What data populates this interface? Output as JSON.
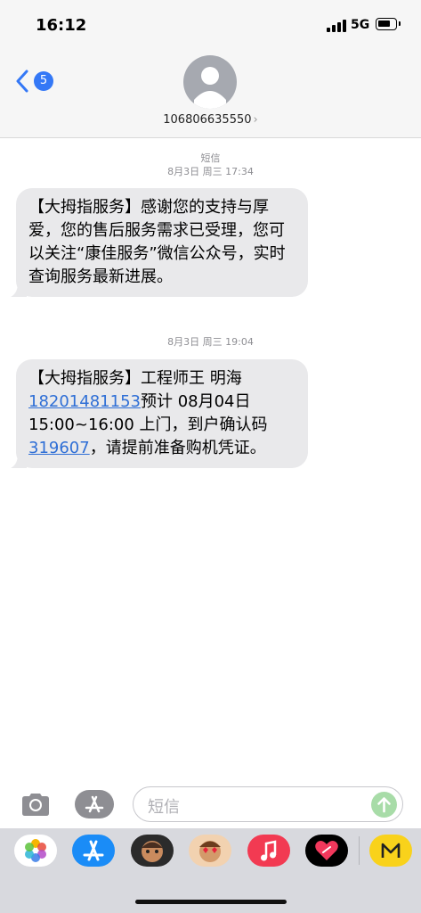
{
  "status": {
    "time": "16:12",
    "network": "5G"
  },
  "header": {
    "back_badge": "5",
    "contact": "106806635550",
    "chevron": "›"
  },
  "messages": [
    {
      "service": "短信",
      "timestamp": "8月3日 周三 17:34",
      "text": "【大拇指服务】感谢您的支持与厚爱，您的售后服务需求已受理，您可以关注“康佳服务”微信公众号，实时查询服务最新进展。"
    },
    {
      "timestamp": "8月3日 周三 19:04",
      "text_1": "【大拇指服务】工程师王 明海",
      "phone": "18201481153",
      "text_2": "预计 08月04日 15:00~16:00 上门，到户确认码",
      "code": "319607",
      "text_3": "，请提前准备购机凭证。"
    }
  ],
  "input": {
    "placeholder": "短信"
  },
  "dock": [
    "photos-icon",
    "app-store-icon",
    "memoji-icon",
    "animoji-icon",
    "music-icon",
    "digital-touch-icon",
    "app-icon"
  ]
}
